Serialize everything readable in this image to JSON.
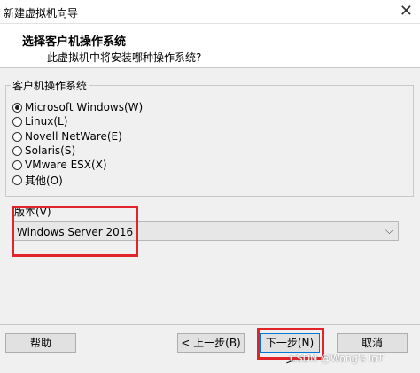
{
  "window": {
    "title": "新建虚拟机向导"
  },
  "header": {
    "title": "选择客户机操作系统",
    "subtitle": "此虚拟机中将安装哪种操作系统?"
  },
  "os_group": {
    "label": "客户机操作系统",
    "options": [
      {
        "label": "Microsoft Windows(W)",
        "selected": true
      },
      {
        "label": "Linux(L)",
        "selected": false
      },
      {
        "label": "Novell NetWare(E)",
        "selected": false
      },
      {
        "label": "Solaris(S)",
        "selected": false
      },
      {
        "label": "VMware ESX(X)",
        "selected": false
      },
      {
        "label": "其他(O)",
        "selected": false
      }
    ]
  },
  "version": {
    "label": "版本(V)",
    "selected": "Windows Server 2016"
  },
  "buttons": {
    "help": "帮助",
    "back": "< 上一步(B)",
    "next": "下一步(N) >",
    "cancel": "取消"
  },
  "watermark": "CSDN @Wong's IoT",
  "colors": {
    "highlight_box": "#e0242a",
    "focus_border": "#0078d7"
  }
}
